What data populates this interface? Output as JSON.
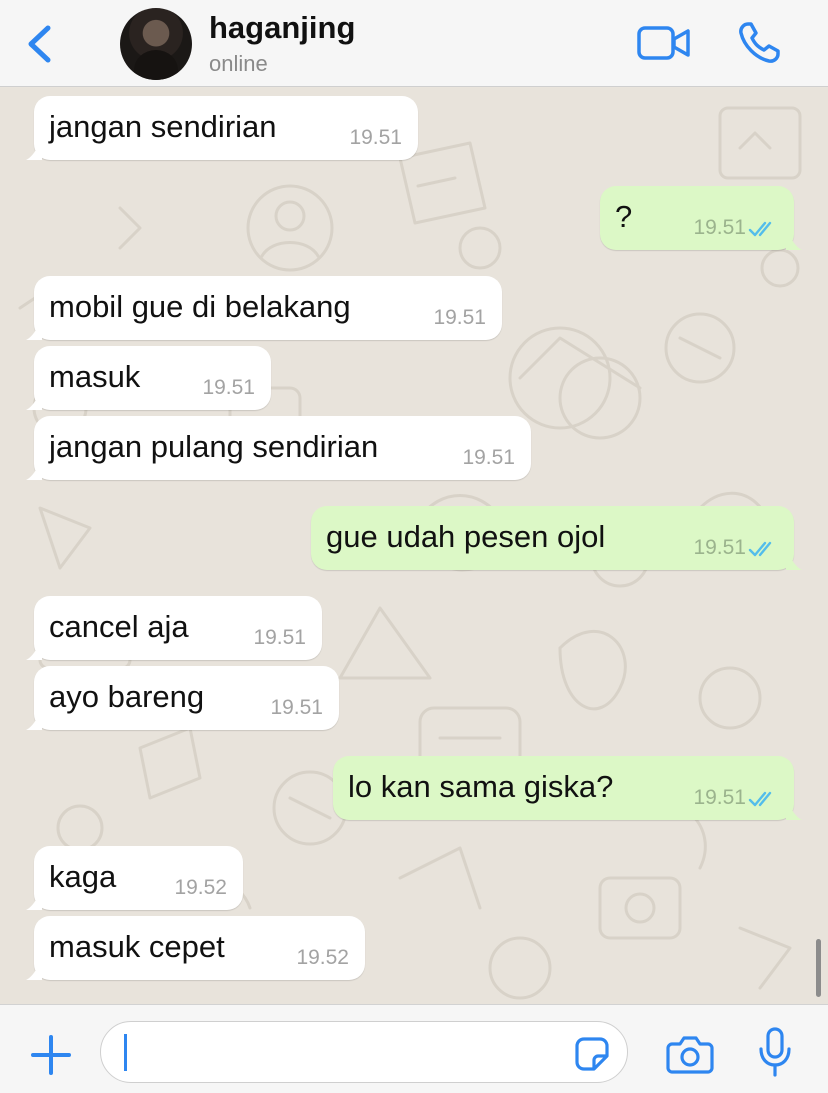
{
  "header": {
    "contact_name": "haganjing",
    "status": "online"
  },
  "messages": [
    {
      "direction": "in",
      "text": "jangan sendirian",
      "time": "19.51"
    },
    {
      "direction": "out",
      "text": "?",
      "time": "19.51",
      "read": true
    },
    {
      "direction": "in",
      "text": "mobil gue di belakang",
      "time": "19.51"
    },
    {
      "direction": "in",
      "text": "masuk",
      "time": "19.51"
    },
    {
      "direction": "in",
      "text": "jangan pulang sendirian",
      "time": "19.51"
    },
    {
      "direction": "out",
      "text": "gue udah pesen ojol",
      "time": "19.51",
      "read": true
    },
    {
      "direction": "in",
      "text": "cancel aja",
      "time": "19.51"
    },
    {
      "direction": "in",
      "text": "ayo bareng",
      "time": "19.51"
    },
    {
      "direction": "out",
      "text": "lo kan sama giska?",
      "time": "19.51",
      "read": true
    },
    {
      "direction": "in",
      "text": "kaga",
      "time": "19.52"
    },
    {
      "direction": "in",
      "text": "masuk cepet",
      "time": "19.52"
    }
  ],
  "composer": {
    "input_value": ""
  },
  "icons": {
    "back": "chevron-left-icon",
    "video": "video-camera-icon",
    "call": "phone-icon",
    "plus": "plus-icon",
    "sticker": "sticker-icon",
    "camera": "camera-icon",
    "mic": "microphone-icon",
    "read_receipt": "double-check-icon"
  },
  "colors": {
    "accent": "#2e86f0",
    "outgoing_bubble": "#dcf8c6",
    "incoming_bubble": "#ffffff",
    "chat_background": "#e8e3db",
    "read_ticks": "#53bdeb"
  }
}
